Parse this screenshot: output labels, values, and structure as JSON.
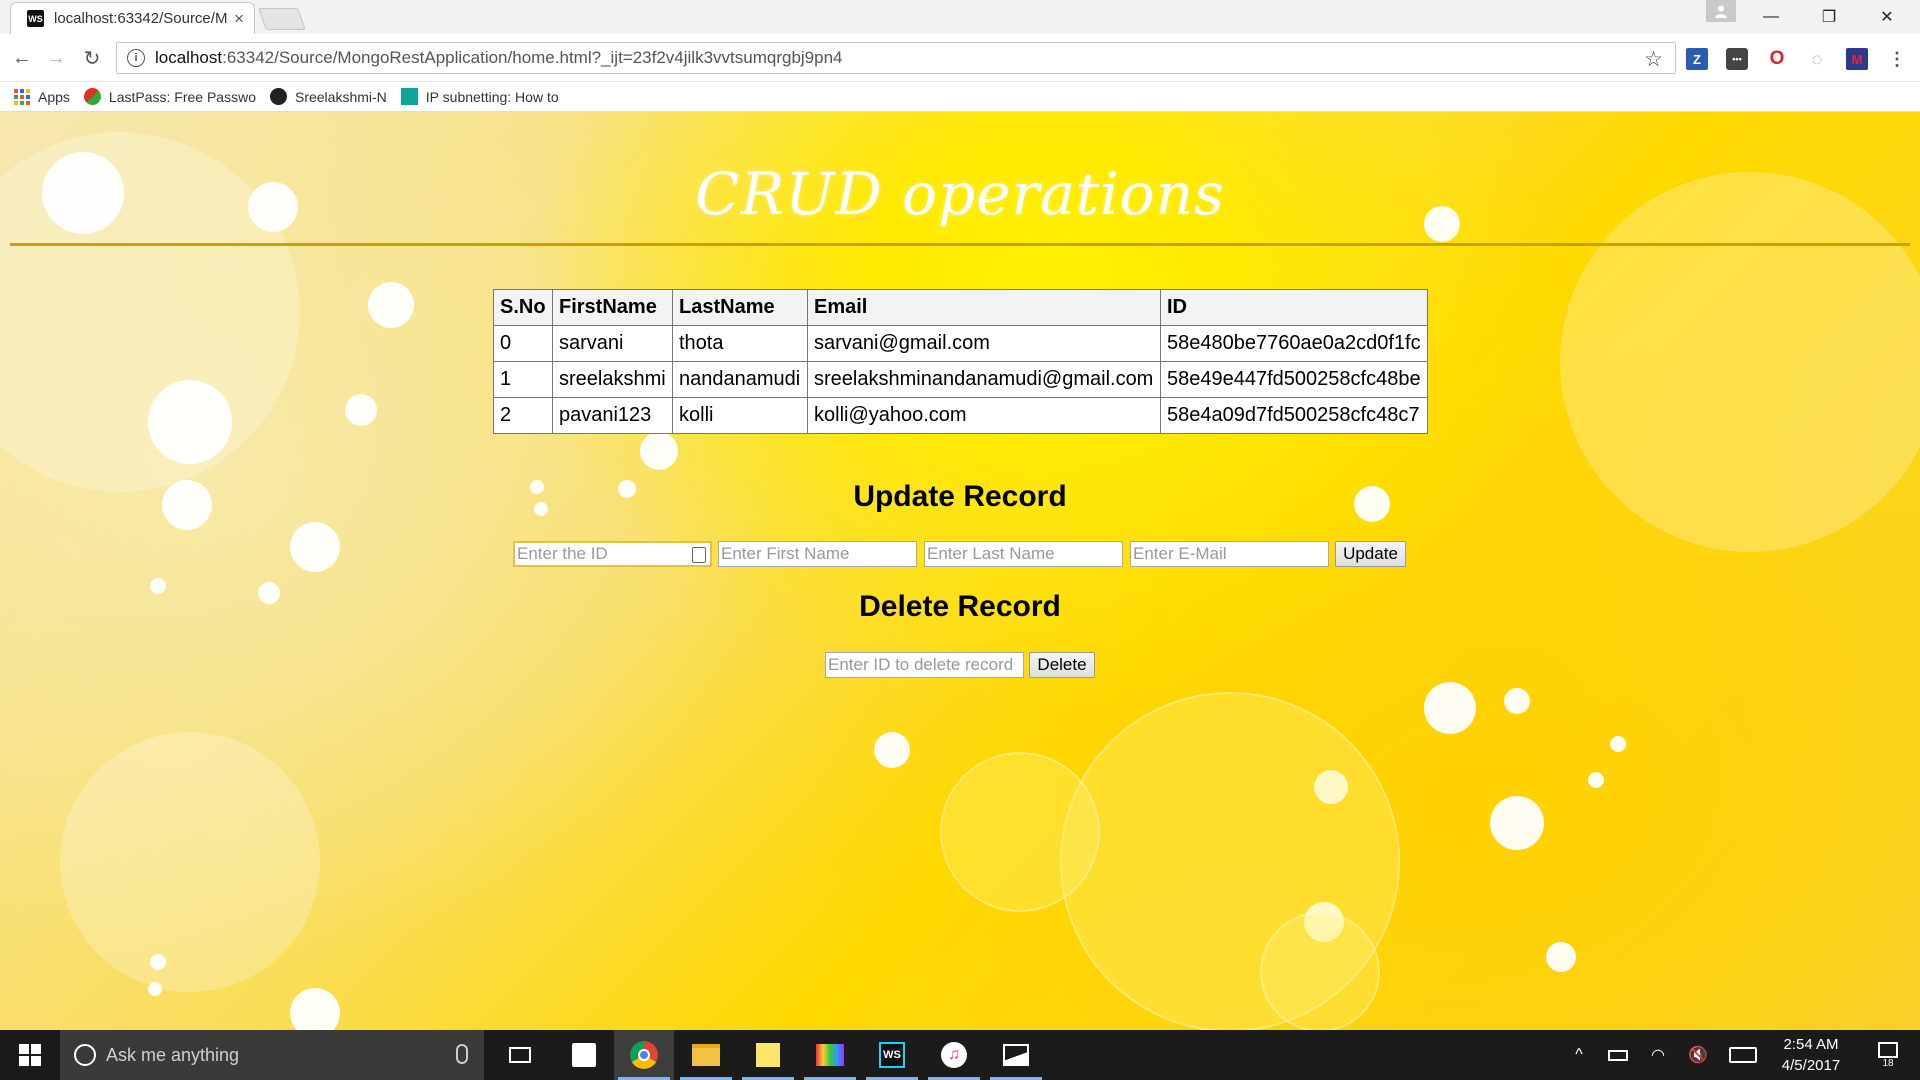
{
  "browser": {
    "tab_title": "localhost:63342/Source/M",
    "tab_close": "×",
    "tab_favicon": "WS",
    "url_host": "localhost",
    "url_path": ":63342/Source/MongoRestApplication/home.html?_ijt=23f2v4jilk3vvtsumqrgbj9pn4",
    "window_controls": {
      "minimize": "—",
      "restore": "❐",
      "close": "✕"
    },
    "extensions": [
      "Z",
      "•••",
      "O",
      "◌",
      "M"
    ],
    "bookmarks": [
      {
        "label": "Apps",
        "icon": "apps-grid-icon"
      },
      {
        "label": "LastPass: Free Passwo",
        "icon": "lastpass-icon"
      },
      {
        "label": "Sreelakshmi-N",
        "icon": "github-icon"
      },
      {
        "label": "IP subnetting: How to",
        "icon": "bookmark-page-icon"
      }
    ]
  },
  "page": {
    "title": "CRUD operations",
    "table": {
      "headers": [
        "S.No",
        "FirstName",
        "LastName",
        "Email",
        "ID"
      ],
      "rows": [
        [
          "0",
          "sarvani",
          "thota",
          "sarvani@gmail.com",
          "58e480be7760ae0a2cd0f1fc"
        ],
        [
          "1",
          "sreelakshmi",
          "nandanamudi",
          "sreelakshminandanamudi@gmail.com",
          "58e49e447fd500258cfc48be"
        ],
        [
          "2",
          "pavani123",
          "kolli",
          "kolli@yahoo.com",
          "58e4a09d7fd500258cfc48c7"
        ]
      ]
    },
    "update": {
      "heading": "Update Record",
      "id_placeholder": "Enter the ID",
      "first_placeholder": "Enter First Name",
      "last_placeholder": "Enter Last Name",
      "email_placeholder": "Enter E-Mail",
      "button": "Update"
    },
    "delete": {
      "heading": "Delete Record",
      "id_placeholder": "Enter ID to delete record",
      "button": "Delete"
    }
  },
  "taskbar": {
    "search_placeholder": "Ask me anything",
    "time": "2:54 AM",
    "date": "4/5/2017",
    "notification_count": "18"
  }
}
